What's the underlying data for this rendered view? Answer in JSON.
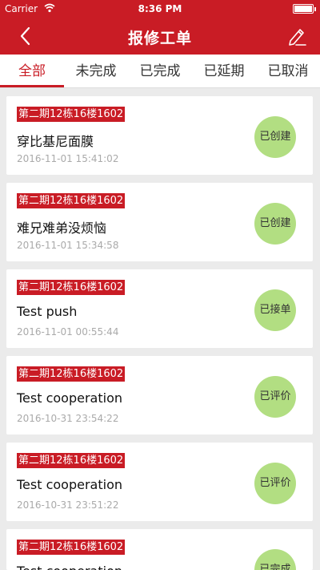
{
  "status_bar": {
    "carrier": "Carrier",
    "time": "8:36 PM"
  },
  "nav": {
    "title": "报修工单",
    "back_icon": "chevron-left-icon",
    "edit_icon": "pencil-edit-icon"
  },
  "tabs": [
    {
      "label": "全部",
      "active": true
    },
    {
      "label": "未完成",
      "active": false
    },
    {
      "label": "已完成",
      "active": false
    },
    {
      "label": "已延期",
      "active": false
    },
    {
      "label": "已取消",
      "active": false
    }
  ],
  "orders": [
    {
      "address": "第二期12栋16楼1602",
      "title": "穿比基尼面膜",
      "datetime": "2016-11-01 15:41:02",
      "status": "已创建"
    },
    {
      "address": "第二期12栋16楼1602",
      "title": "难兄难弟没烦恼",
      "datetime": "2016-11-01 15:34:58",
      "status": "已创建"
    },
    {
      "address": "第二期12栋16楼1602",
      "title": "Test push",
      "datetime": "2016-11-01 00:55:44",
      "status": "已接单"
    },
    {
      "address": "第二期12栋16楼1602",
      "title": "Test cooperation",
      "datetime": "2016-10-31 23:54:22",
      "status": "已评价"
    },
    {
      "address": "第二期12栋16楼1602",
      "title": "Test cooperation",
      "datetime": "2016-10-31 23:51:22",
      "status": "已评价"
    },
    {
      "address": "第二期12栋16楼1602",
      "title": "Test cooperation",
      "datetime": "",
      "status": "已完成"
    }
  ],
  "colors": {
    "brand": "#c91c25",
    "badge": "#b2de82"
  }
}
